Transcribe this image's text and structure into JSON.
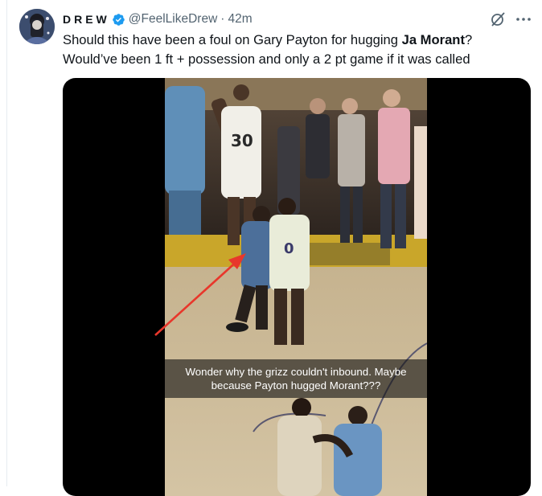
{
  "tweet": {
    "author": {
      "display_name": "DREW",
      "handle": "@FeelLikeDrew",
      "time": "42m",
      "verified": true
    },
    "text": {
      "line1_before": "Should this have been a foul on Gary Payton for hugging ",
      "line1_bold": "Ja Morant",
      "line1_after": "?",
      "line2": "Would’ve been 1 ft + possession and only a 2 pt game if it was called"
    },
    "media": {
      "caption_line1": "Wonder why the grizz couldn't inbound. Maybe",
      "caption_line2": "because Payton hugged Morant???",
      "jerseys": {
        "top_white_player": "30",
        "defender_number": "0"
      }
    },
    "icons": [
      "verified-badge-icon",
      "grok-icon",
      "more-icon",
      "annotation-arrow-icon"
    ]
  },
  "colors": {
    "verified": "#1d9bf0",
    "secondary_text": "#536471",
    "arrow": "#e8372b"
  }
}
